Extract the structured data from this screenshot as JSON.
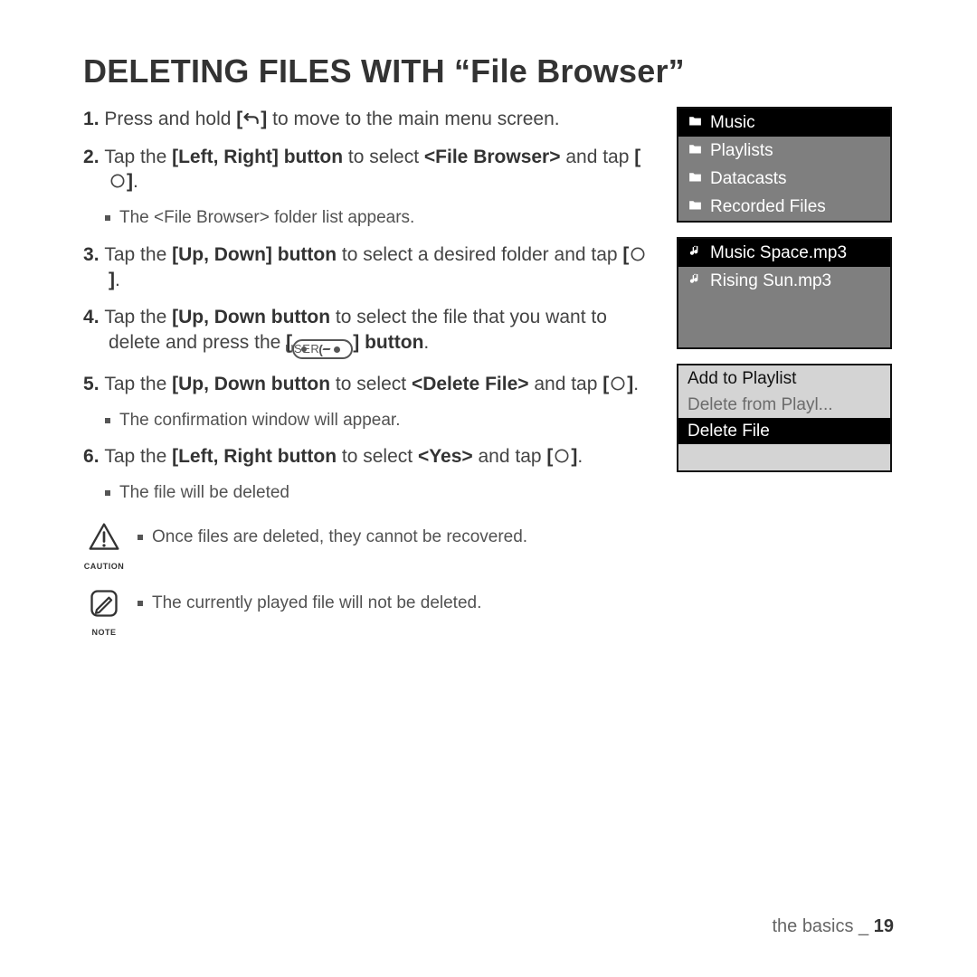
{
  "title": "DELETING FILES WITH “File Browser”",
  "steps": {
    "s1a": "Press and hold ",
    "s1b": " to move to the main menu screen.",
    "s2a": "Tap the ",
    "s2b": "Left, Right] button",
    "s2c": " to select ",
    "s2d": "<File Browser>",
    "s2e": " and tap ",
    "s2sub": "The <File Browser> folder list appears.",
    "s3a": "Tap the ",
    "s3b": "Up, Down] button",
    "s3c": " to select a desired folder and tap ",
    "s4a": "Tap the ",
    "s4b": "Up, Down button",
    "s4c": " to select the file that you want to delete and press the ",
    "s4d": " button",
    "s5a": "Tap the ",
    "s5b": "Up, Down button",
    "s5c": " to select ",
    "s5d": "<Delete File>",
    "s5e": " and tap ",
    "s5sub": "The confirmation window will appear.",
    "s6a": "Tap the ",
    "s6b": "Left, Right button",
    "s6c": " to select ",
    "s6d": "<Yes>",
    "s6e": " and tap ",
    "s6sub": "The file will be deleted"
  },
  "caution": {
    "label": "CAUTION",
    "text": "Once files are deleted, they cannot be recovered."
  },
  "note": {
    "label": "NOTE",
    "text": "The currently played file will not be deleted."
  },
  "panel1": {
    "item0": "Music",
    "item1": "Playlists",
    "item2": "Datacasts",
    "item3": "Recorded Files"
  },
  "panel2": {
    "item0": "Music Space.mp3",
    "item1": "Rising Sun.mp3"
  },
  "panel3": {
    "item0": "Add to Playlist",
    "item1": "Delete from Playl...",
    "item2": "Delete File"
  },
  "user_label": "USER",
  "footer": {
    "section": "the basics _ ",
    "page": "19"
  }
}
